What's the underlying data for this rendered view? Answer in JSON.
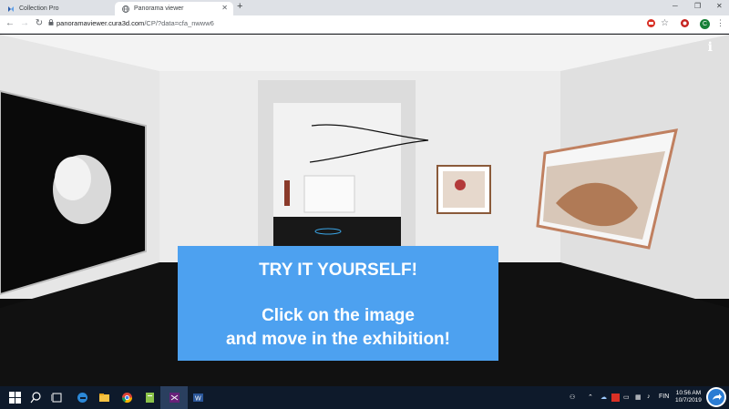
{
  "tabs": [
    {
      "label": "Collection Pro",
      "active": false
    },
    {
      "label": "Panorama viewer",
      "active": true
    }
  ],
  "toolbar": {
    "url_host": "panoramaviewer.cura3d.com",
    "url_path": "/CP/?data=cfa_nwww6",
    "avatar_letter": "C"
  },
  "scene": {
    "info_label": "i",
    "cta": {
      "line1": "TRY IT YOURSELF!",
      "line2": "Click on the image",
      "line3": "and move in the exhibition!"
    }
  },
  "taskbar": {
    "time": "10:56 AM",
    "date": "10/7/2019",
    "lang": "FIN"
  },
  "colors": {
    "cta_bg": "#4da1f0",
    "taskbar_bg": "#0e1a2b"
  }
}
